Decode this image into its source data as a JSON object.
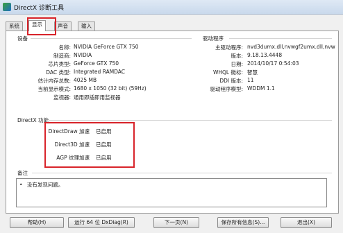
{
  "window": {
    "title": "DirectX 诊断工具"
  },
  "tabs": [
    {
      "label": "系统"
    },
    {
      "label": "显示"
    },
    {
      "label": "声音"
    },
    {
      "label": "输入"
    }
  ],
  "device": {
    "title": "设备",
    "rows": [
      {
        "label": "名称:",
        "value": "NVIDIA GeForce GTX 750"
      },
      {
        "label": "制造商:",
        "value": "NVIDIA"
      },
      {
        "label": "芯片类型:",
        "value": "GeForce GTX 750"
      },
      {
        "label": "DAC 类型:",
        "value": "Integrated RAMDAC"
      },
      {
        "label": "估计内存总数:",
        "value": "4025 MB"
      },
      {
        "label": "当前显示模式:",
        "value": "1680 x 1050 (32 bit) (59Hz)"
      },
      {
        "label": "监视器:",
        "value": "通用即插即用监视器"
      }
    ]
  },
  "drivers": {
    "title": "驱动程序",
    "rows": [
      {
        "label": "主驱动程序:",
        "value": "nvd3dumx.dll,nvwgf2umx.dll,nvw"
      },
      {
        "label": "版本:",
        "value": "9.18.13.4448"
      },
      {
        "label": "日期:",
        "value": "2014/10/17 0:54:03"
      },
      {
        "label": "WHQL 徽标:",
        "value": "智慧"
      },
      {
        "label": "DDI 版本:",
        "value": "11"
      },
      {
        "label": "驱动程序模型:",
        "value": "WDDM 1.1"
      }
    ]
  },
  "features": {
    "title": "DirectX 功能",
    "rows": [
      {
        "label": "DirectDraw 加速",
        "value": "已启用"
      },
      {
        "label": "Direct3D 加速",
        "value": "已启用"
      },
      {
        "label": "AGP 纹理加速",
        "value": "已启用"
      }
    ]
  },
  "notes": {
    "title": "备注",
    "items": [
      "没有发现问题。"
    ]
  },
  "buttons": {
    "help": "帮助(H)",
    "run64": "运行 64 位 DxDiag(R)",
    "next": "下一页(N)",
    "save": "保存所有信息(S)...",
    "exit": "退出(X)"
  }
}
